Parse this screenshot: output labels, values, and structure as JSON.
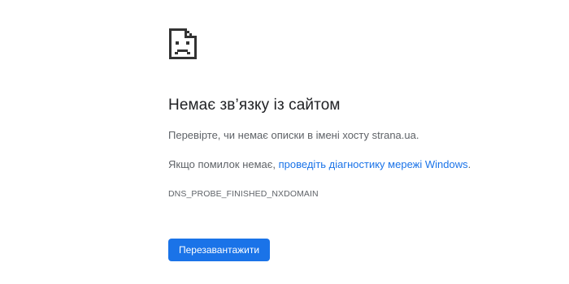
{
  "error": {
    "icon": "sad-page-icon",
    "title": "Немає зв’язку із сайтом",
    "message": "Перевірте, чи немає описки в імені хосту strana.ua.",
    "suggestion_prefix": "Якщо помилок немає, ",
    "suggestion_link": "проведіть діагностику мережі Windows",
    "suggestion_suffix": ".",
    "code": "DNS_PROBE_FINISHED_NXDOMAIN"
  },
  "actions": {
    "reload_label": "Перезавантажити"
  },
  "colors": {
    "accent": "#1a73e8",
    "text_primary": "#202124",
    "text_secondary": "#5f6368"
  }
}
